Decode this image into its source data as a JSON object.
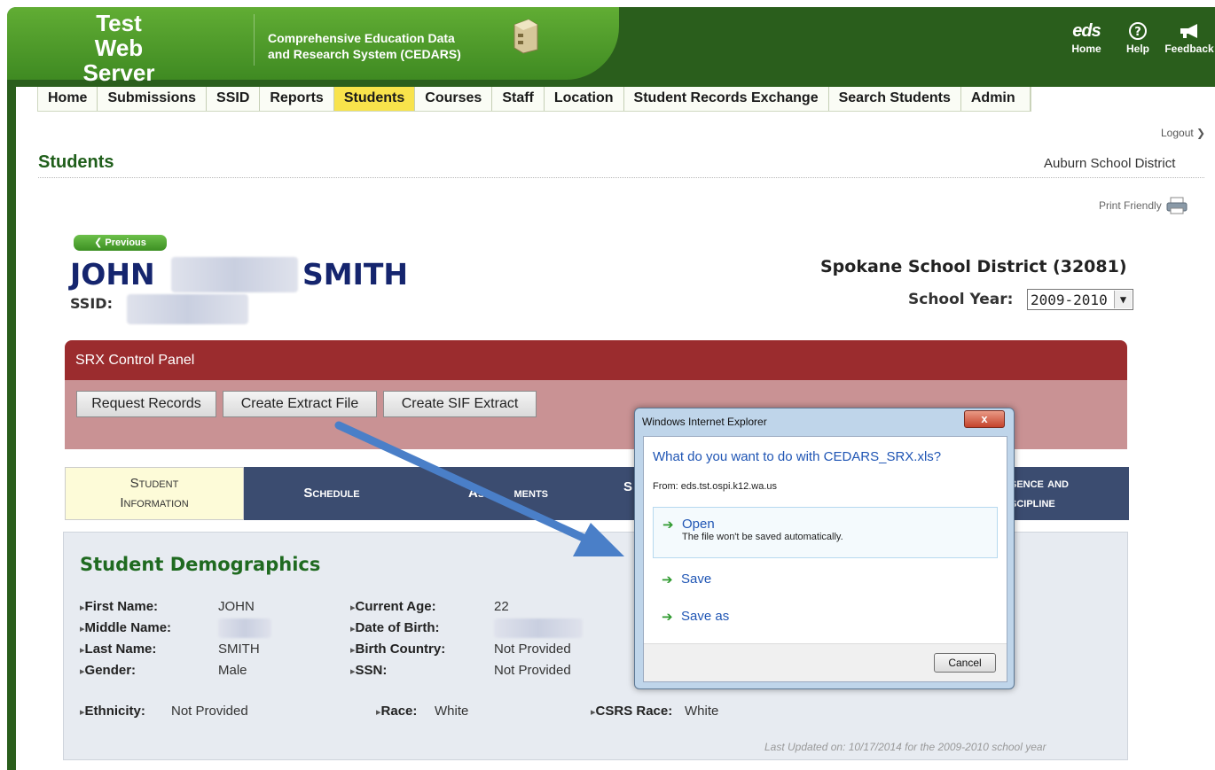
{
  "header": {
    "server_title": "Test Web Server",
    "system_line1": "Comprehensive Education Data",
    "system_line2": "and Research System (CEDARS)",
    "links": [
      {
        "label": "Home",
        "logo": "eds"
      },
      {
        "label": "Help",
        "icon": "help-icon"
      },
      {
        "label": "Feedback",
        "icon": "megaphone-icon"
      }
    ]
  },
  "nav": {
    "items": [
      "Home",
      "Submissions",
      "SSID",
      "Reports",
      "Students",
      "Courses",
      "Staff",
      "Location",
      "Student Records Exchange",
      "Search Students",
      "Admin"
    ],
    "active": "Students"
  },
  "page": {
    "logout": "Logout",
    "title": "Students",
    "district": "Auburn School District",
    "print_friendly": "Print Friendly"
  },
  "student": {
    "previous": "Previous",
    "first_name": "JOHN",
    "last_name": "SMITH",
    "ssid_label": "SSID:",
    "school_district": "Spokane School District (32081)",
    "school_year_label": "School Year:",
    "school_year": "2009-2010"
  },
  "srx": {
    "title": "SRX Control Panel",
    "buttons": [
      "Request Records",
      "Create Extract File",
      "Create SIF Extract"
    ]
  },
  "tabs": {
    "student_info_line1": "Student",
    "student_info_line2": "Information",
    "schedule": "Schedule",
    "assessments_part1": "Ass",
    "assessments_part2": "ments",
    "partial_s": "S",
    "absence_line1": "sence and",
    "absence_line2": "scipline"
  },
  "demographics": {
    "title": "Student Demographics",
    "fields": {
      "first_name_label": "First Name:",
      "first_name": "JOHN",
      "middle_name_label": "Middle Name:",
      "last_name_label": "Last Name:",
      "last_name": "SMITH",
      "gender_label": "Gender:",
      "gender": "Male",
      "current_age_label": "Current Age:",
      "current_age": "22",
      "dob_label": "Date of Birth:",
      "birth_country_label": "Birth Country:",
      "birth_country": "Not Provided",
      "ssn_label": "SSN:",
      "ssn": "Not Provided",
      "ethnicity_label": "Ethnicity:",
      "ethnicity": "Not Provided",
      "race_label": "Race:",
      "race": "White",
      "csrs_race_label": "CSRS Race:",
      "csrs_race": "White"
    },
    "last_updated": "Last Updated on: 10/17/2014 for the 2009-2010 school year"
  },
  "dialog": {
    "title": "Windows Internet Explorer",
    "close": "x",
    "question": "What do you want to do with CEDARS_SRX.xls?",
    "from": "From: eds.tst.ospi.k12.wa.us",
    "open_label": "Open",
    "open_sub": "The file won't be saved automatically.",
    "save_label": "Save",
    "save_as_label": "Save as",
    "cancel": "Cancel"
  },
  "colors": {
    "header_green": "#2a5e1c",
    "nav_active": "#f8e34b",
    "srx_red": "#9b2c2e",
    "tab_blue": "#3b4c70",
    "title_green": "#1f6a20",
    "arrow_blue": "#4a7fc8"
  }
}
